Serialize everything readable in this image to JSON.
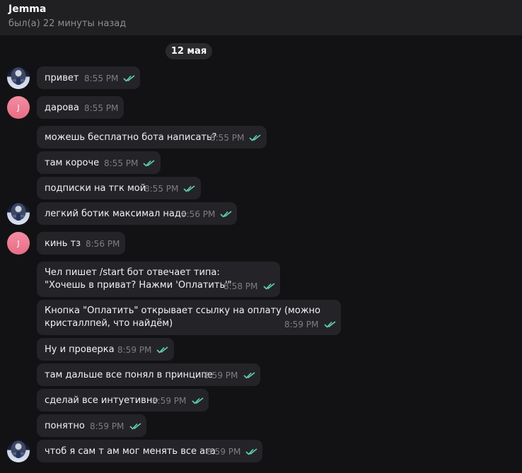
{
  "header": {
    "title": "Jemma",
    "status": "был(а) 22 минуты назад"
  },
  "date_separator": "12 мая",
  "contact_initial": "J",
  "colors": {
    "accent_tick": "#5fd3b3"
  },
  "messages": [
    {
      "text": "привет",
      "time": "8:55 PM",
      "read": true
    },
    {
      "text": "дарова",
      "time": "8:55 PM",
      "read": false
    },
    {
      "text": "можешь бесплатно бота написать?",
      "time": "8:55 PM",
      "read": true
    },
    {
      "text": "там короче",
      "time": "8:55 PM",
      "read": true
    },
    {
      "text": "подписки на тгк мой",
      "time": "8:55 PM",
      "read": true
    },
    {
      "text": "легкий ботик максимал надо",
      "time": "8:56 PM",
      "read": true
    },
    {
      "text": "кинь тз",
      "time": "8:56 PM",
      "read": false
    },
    {
      "text": "Чел пишет /start бот отвечает типа:",
      "text2": "\"Хочешь в приват? Нажми 'Оплатить'\"",
      "time": "8:58 PM",
      "read": true
    },
    {
      "text": "Кнопка \"Оплатить\" открывает ссылку на оплату (можно",
      "text2": "кристаллпей, что найдём)",
      "time": "8:59 PM",
      "read": true
    },
    {
      "text": "Ну и проверка",
      "time": "8:59 PM",
      "read": true
    },
    {
      "text": "там дальше все понял в принципе",
      "time": "8:59 PM",
      "read": true
    },
    {
      "text": "сделай все интуетивно",
      "time": "8:59 PM",
      "read": true
    },
    {
      "text": "понятно",
      "time": "8:59 PM",
      "read": true
    },
    {
      "text": "чтоб я сам т ам мог менять все ага",
      "time": "8:59 PM",
      "read": true
    }
  ]
}
